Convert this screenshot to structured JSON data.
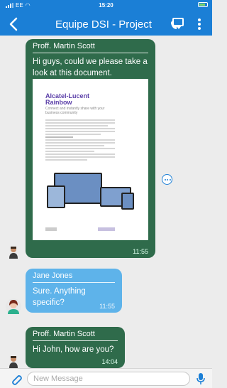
{
  "status_bar": {
    "carrier": "EE",
    "time": "15:20"
  },
  "header": {
    "title": "Equipe DSI - Project",
    "colors": {
      "bar": "#1b7fd6"
    }
  },
  "messages": [
    {
      "sender": "Proff. Martin Scott",
      "text": "Hi guys, could we please take a look at this document.",
      "time": "11:55",
      "attachment": {
        "title_line1": "Alcatel-Lucent",
        "title_line2": "Rainbow",
        "subtitle": "Connect and instantly share with your business community"
      },
      "color": "#2f6b4b"
    },
    {
      "sender": "Jane Jones",
      "text": "Sure. Anything specific?",
      "time": "11:55",
      "color": "#5eb3ea"
    },
    {
      "sender": "Proff. Martin Scott",
      "text": "Hi John, how are you?",
      "time": "14:04",
      "color": "#2f6b4b"
    }
  ],
  "composer": {
    "placeholder": "New Message"
  },
  "icons": [
    "back-icon",
    "video-call-icon",
    "more-icon",
    "attachment-icon",
    "microphone-icon",
    "more-options-icon"
  ]
}
